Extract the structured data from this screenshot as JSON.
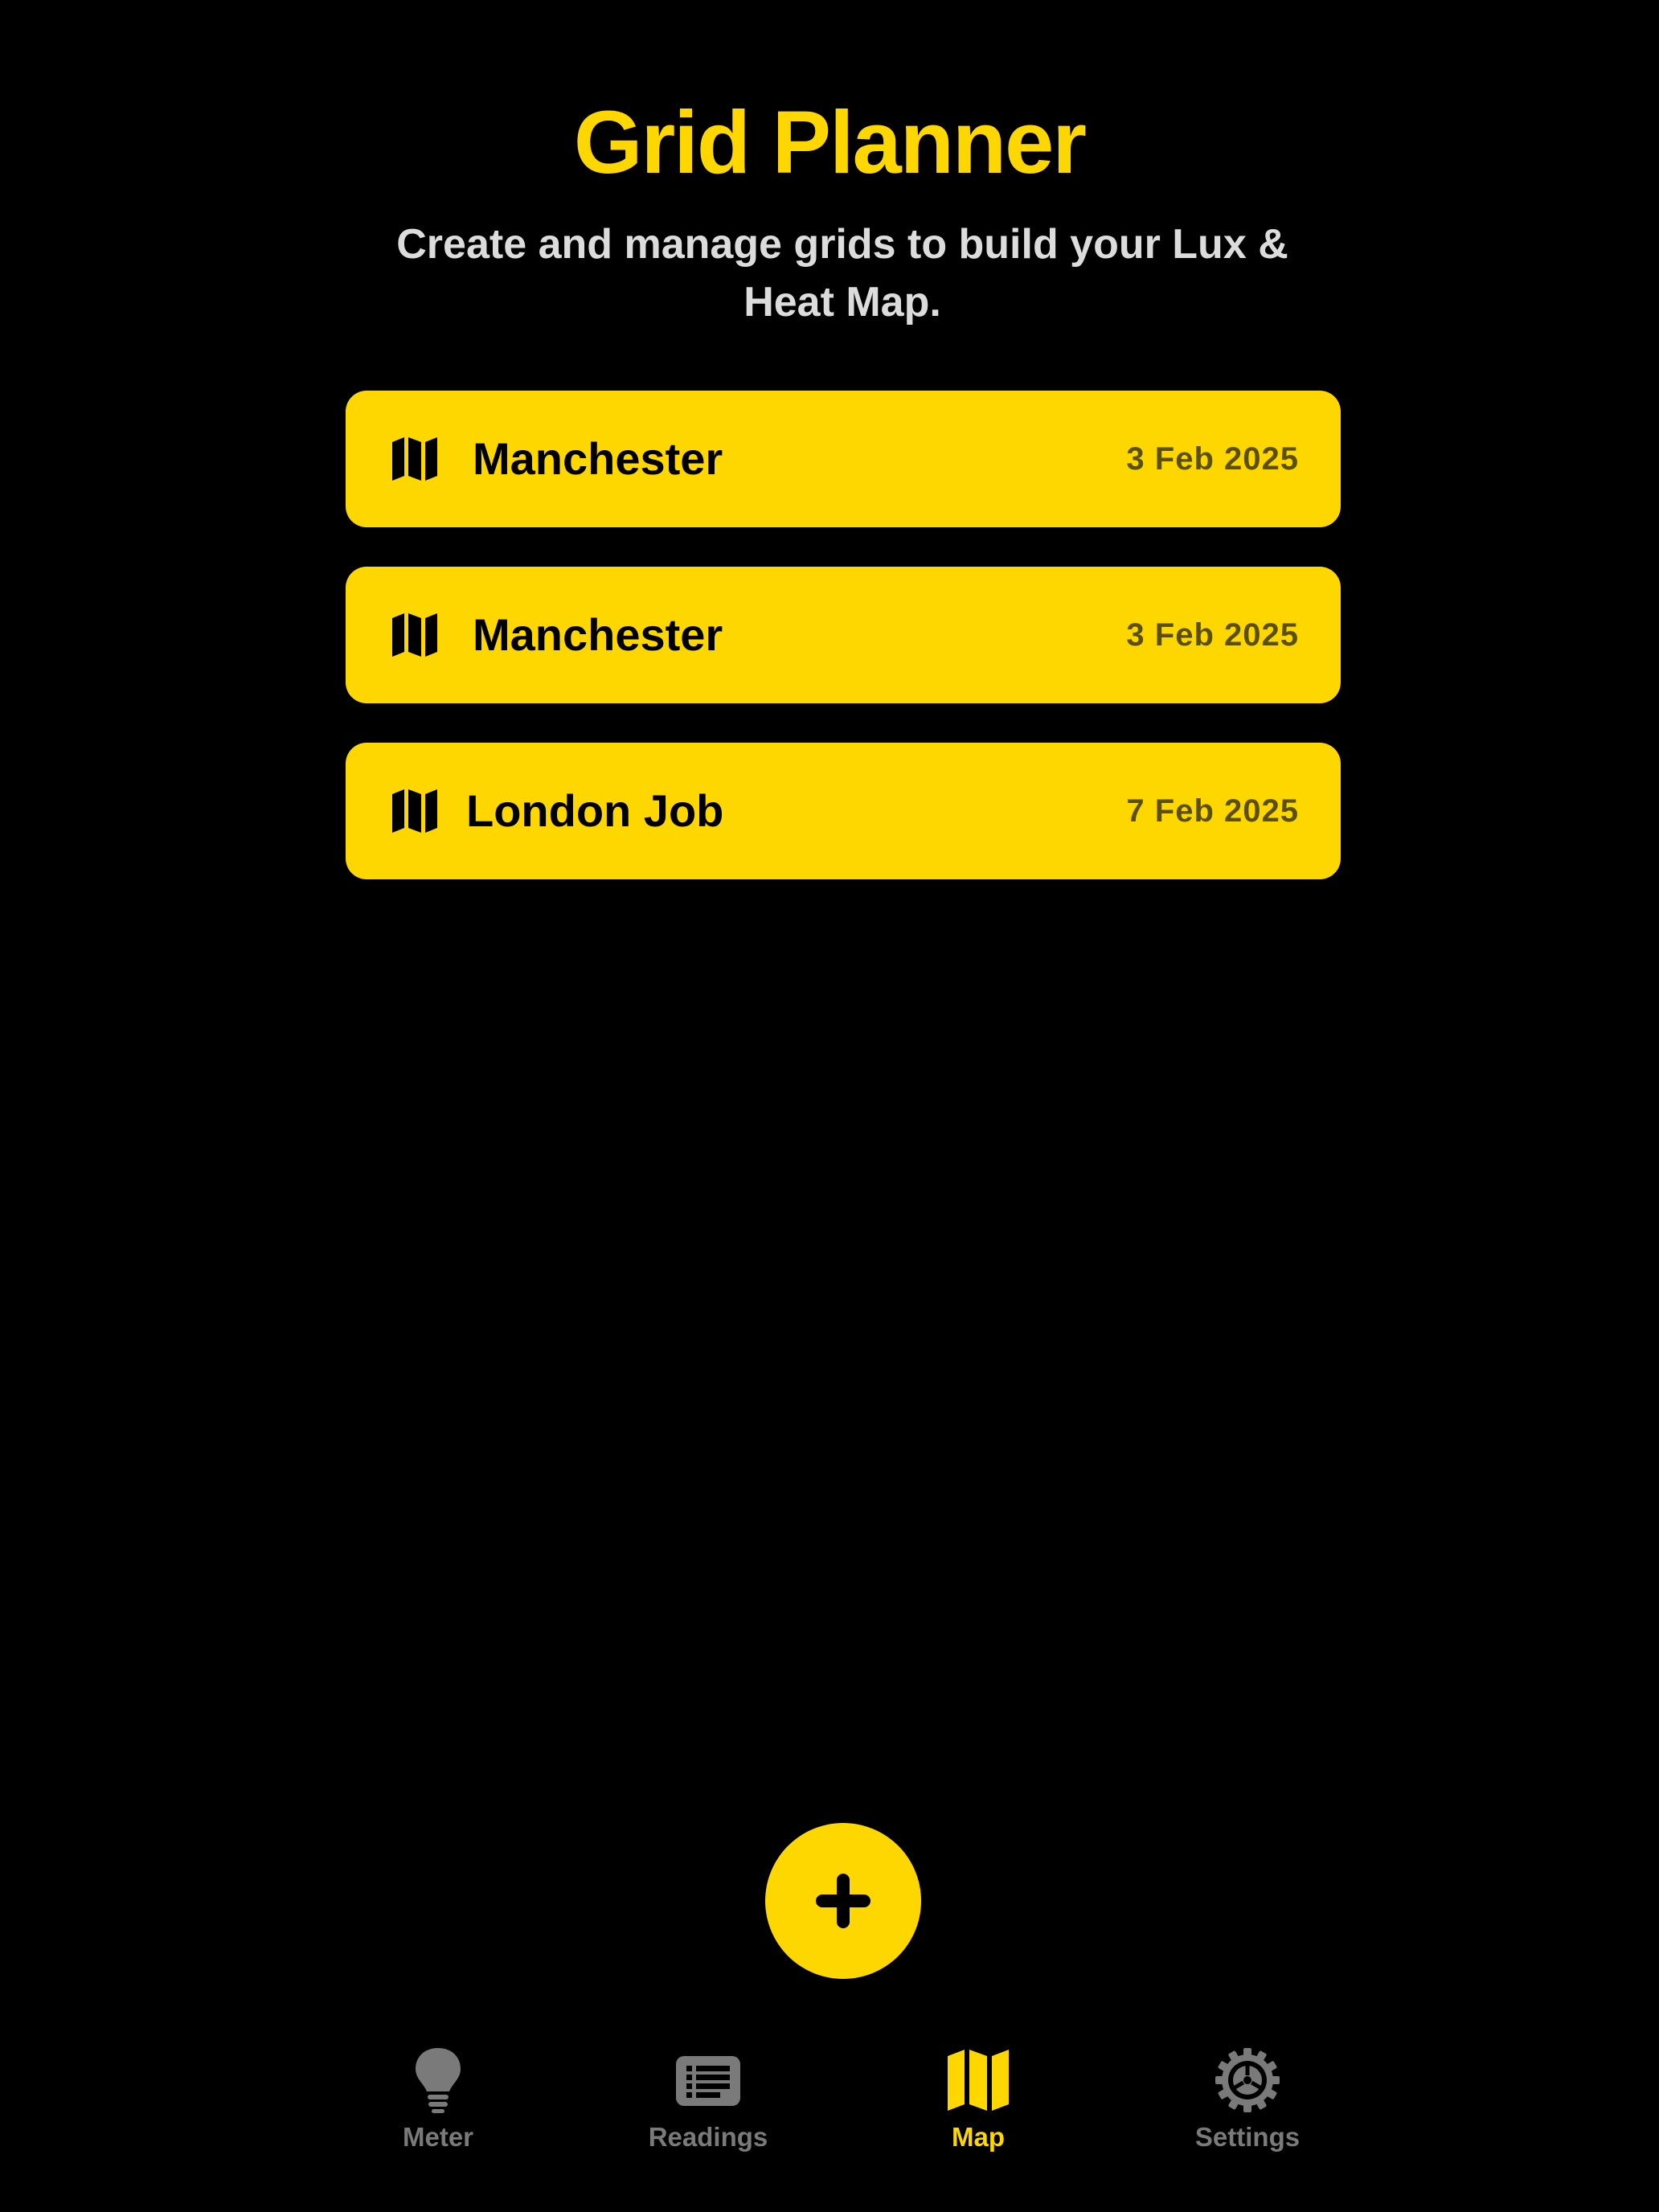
{
  "header": {
    "title": "Grid Planner",
    "subtitle": "Create and manage grids to build your Lux & Heat Map."
  },
  "grids": [
    {
      "name": "Manchester",
      "date": "3 Feb 2025",
      "icon": "map-icon"
    },
    {
      "name": "Manchester",
      "date": "3 Feb 2025",
      "icon": "map-icon"
    },
    {
      "name": "London Job",
      "date": "7 Feb 2025",
      "icon": "map-icon"
    }
  ],
  "add_button": {
    "icon": "plus-icon"
  },
  "tab_bar": {
    "items": [
      {
        "label": "Meter",
        "icon": "lightbulb-icon",
        "active": false
      },
      {
        "label": "Readings",
        "icon": "list-icon",
        "active": false
      },
      {
        "label": "Map",
        "icon": "map-icon",
        "active": true
      },
      {
        "label": "Settings",
        "icon": "gear-icon",
        "active": false
      }
    ]
  },
  "colors": {
    "background": "#000000",
    "accent": "#FFD700",
    "subtitle": "#DCDCDC",
    "inactive_tab": "#7A7A7A",
    "card_text": "#000000",
    "card_date": "#5A5000"
  }
}
